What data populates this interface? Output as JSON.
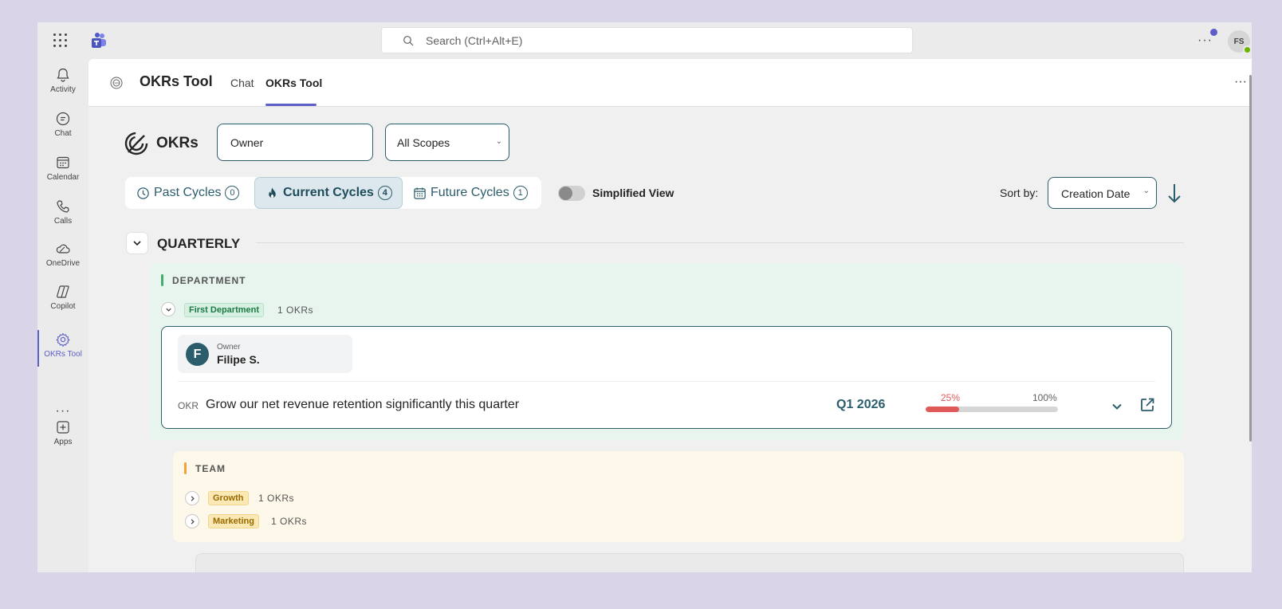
{
  "topbar": {
    "search_placeholder": "Search (Ctrl+Alt+E)",
    "more_label": "···",
    "user_initials": "FS"
  },
  "rail": {
    "items": [
      {
        "label": "Activity",
        "icon": "bell-icon"
      },
      {
        "label": "Chat",
        "icon": "chat-icon"
      },
      {
        "label": "Calendar",
        "icon": "calendar-icon"
      },
      {
        "label": "Calls",
        "icon": "phone-icon"
      },
      {
        "label": "OneDrive",
        "icon": "cloud-icon"
      },
      {
        "label": "Copilot",
        "icon": "copilot-icon"
      },
      {
        "label": "OKRs Tool",
        "icon": "gear-icon",
        "active": true
      },
      {
        "label": "Apps",
        "icon": "add-icon"
      }
    ],
    "more_label": "···"
  },
  "app": {
    "title": "OKRs Tool",
    "tabs": [
      {
        "label": "Chat",
        "active": false
      },
      {
        "label": "OKRs Tool",
        "active": true
      }
    ],
    "more_label": "···"
  },
  "filters": {
    "page_title": "OKRs",
    "owner_placeholder": "Owner",
    "scope_value": "All Scopes",
    "cycles": [
      {
        "label": "Past Cycles",
        "count": "0",
        "active": false
      },
      {
        "label": "Current Cycles",
        "count": "4",
        "active": true
      },
      {
        "label": "Future Cycles",
        "count": "1",
        "active": false
      }
    ],
    "simplified_view_label": "Simplified View",
    "simplified_view_on": false,
    "sort_label": "Sort by:",
    "sort_value": "Creation Date"
  },
  "quarterly": {
    "title": "QUARTERLY",
    "department": {
      "section_label": "DEPARTMENT",
      "group_name": "First Department",
      "group_count": "1 OKRs",
      "okr": {
        "owner_caption": "Owner",
        "owner_name": "Filipe S.",
        "owner_initial": "F",
        "kind": "OKR",
        "title": "Grow our net revenue retention significantly this quarter",
        "cycle": "Q1 2026",
        "progress_label": "25%",
        "progress_max_label": "100%",
        "progress_value": 0.25
      }
    },
    "team": {
      "section_label": "TEAM",
      "groups": [
        {
          "name": "Growth",
          "count": "1 OKRs"
        },
        {
          "name": "Marketing",
          "count": "1 OKRs"
        }
      ]
    }
  },
  "colors": {
    "accent": "#5b5fc7",
    "teal": "#2c5d6c",
    "dept_bg": "#e8f5ef",
    "dept_bar": "#3fae6f",
    "team_bg": "#fdf8e9",
    "team_bar": "#f2a33c",
    "progress": "#e05a5a"
  }
}
